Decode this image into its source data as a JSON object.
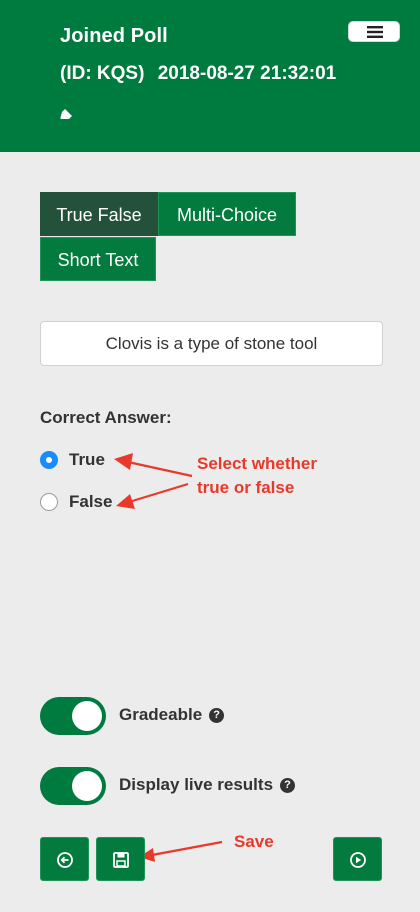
{
  "header": {
    "title": "Joined Poll",
    "poll_id": "(ID: KQS)",
    "timestamp": "2018-08-27 21:32:01",
    "background": "#007b3f"
  },
  "icons": {
    "edit": "pencil-icon",
    "menu": "hamburger-menu-icon",
    "back": "circle-left-arrow-icon",
    "save": "floppy-disk-icon",
    "next": "circle-play-icon",
    "help": "question-circle-icon"
  },
  "tabs": [
    {
      "label": "True False",
      "active": true
    },
    {
      "label": "Multi-Choice",
      "active": false
    },
    {
      "label": "Short Text",
      "active": false
    }
  ],
  "question": {
    "value": "Clovis is a type of stone tool"
  },
  "answer": {
    "heading": "Correct Answer:",
    "options": [
      {
        "label": "True",
        "selected": true
      },
      {
        "label": "False",
        "selected": false
      }
    ]
  },
  "annotations": {
    "select": "Select whether true or false",
    "save": "Save",
    "color": "#e8392b"
  },
  "settings": {
    "gradeable": {
      "label": "Gradeable",
      "on": true
    },
    "live_results": {
      "label": "Display live results",
      "on": true
    },
    "help_glyph": "?"
  },
  "colors": {
    "primary": "#007b3f",
    "active_tab": "#24513a",
    "radio_selected": "#1a8cf5"
  }
}
